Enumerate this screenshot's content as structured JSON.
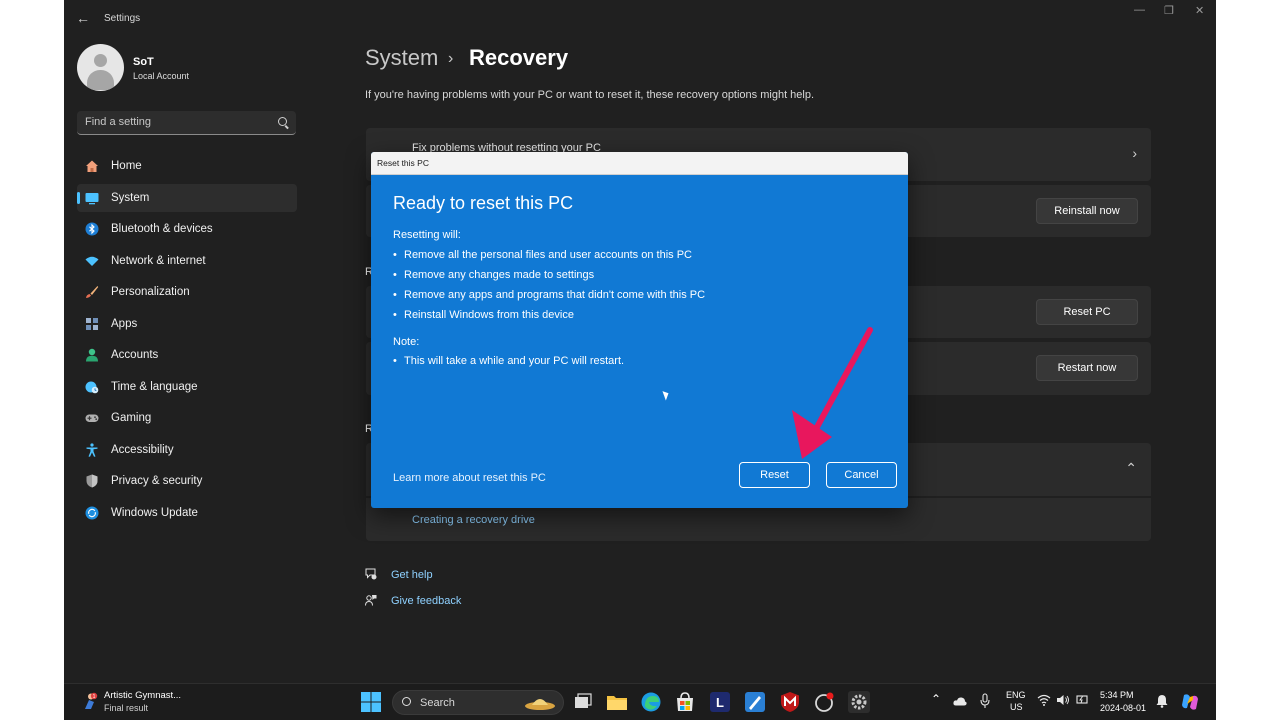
{
  "window": {
    "title": "Settings"
  },
  "user": {
    "name": "SoT",
    "account_type": "Local Account"
  },
  "search": {
    "placeholder": "Find a setting"
  },
  "nav": {
    "items": [
      {
        "label": "Home",
        "icon": "home-icon",
        "color": "#f2a07b"
      },
      {
        "label": "System",
        "icon": "system-icon",
        "color": "#4cc2ff",
        "active": true
      },
      {
        "label": "Bluetooth & devices",
        "icon": "bluetooth-icon",
        "color": "#4cc2ff"
      },
      {
        "label": "Network & internet",
        "icon": "wifi-icon",
        "color": "#4cc2ff"
      },
      {
        "label": "Personalization",
        "icon": "brush-icon",
        "color": "#f0b27a"
      },
      {
        "label": "Apps",
        "icon": "apps-icon",
        "color": "#9fb4d0"
      },
      {
        "label": "Accounts",
        "icon": "person-icon",
        "color": "#3ec38a"
      },
      {
        "label": "Time & language",
        "icon": "globe-clock-icon",
        "color": "#4cc2ff"
      },
      {
        "label": "Gaming",
        "icon": "gamepad-icon",
        "color": "#b0b0b0"
      },
      {
        "label": "Accessibility",
        "icon": "accessibility-icon",
        "color": "#4cc2ff"
      },
      {
        "label": "Privacy & security",
        "icon": "shield-icon",
        "color": "#b0b0b0"
      },
      {
        "label": "Windows Update",
        "icon": "update-icon",
        "color": "#4cc2ff"
      }
    ]
  },
  "breadcrumb": {
    "parent": "System",
    "separator": "›",
    "current": "Recovery"
  },
  "page": {
    "subtitle": "If you're having problems with your PC or want to reset it, these recovery options might help.",
    "fix_card_title": "Fix problems without resetting your PC",
    "reinstall_button": "Reinstall now",
    "section_letter_1": "R",
    "reset_button": "Reset PC",
    "restart_button": "Restart now",
    "section_letter_2": "R",
    "recovery_drive_link": "Creating a recovery drive",
    "get_help": "Get help",
    "give_feedback": "Give feedback"
  },
  "dialog": {
    "window_title": "Reset this PC",
    "heading": "Ready to reset this PC",
    "lead": "Resetting will:",
    "items": [
      "Remove all the personal files and user accounts on this PC",
      "Remove any changes made to settings",
      "Remove any apps and programs that didn't come with this PC",
      "Reinstall Windows from this device"
    ],
    "note_label": "Note:",
    "note_items": [
      "This will take a while and your PC will restart."
    ],
    "learn_more": "Learn more about reset this PC",
    "reset_button": "Reset",
    "cancel_button": "Cancel",
    "accent_color": "#1179d4"
  },
  "annotation": {
    "arrow_color": "#e8175d"
  },
  "taskbar": {
    "news_title": "Artistic Gymnast...",
    "news_subtitle": "Final result",
    "news_badge": "1",
    "search_label": "Search",
    "lang_top": "ENG",
    "lang_bottom": "US",
    "time": "5:34 PM",
    "date": "2024-08-01",
    "pinned_letter": "L"
  }
}
